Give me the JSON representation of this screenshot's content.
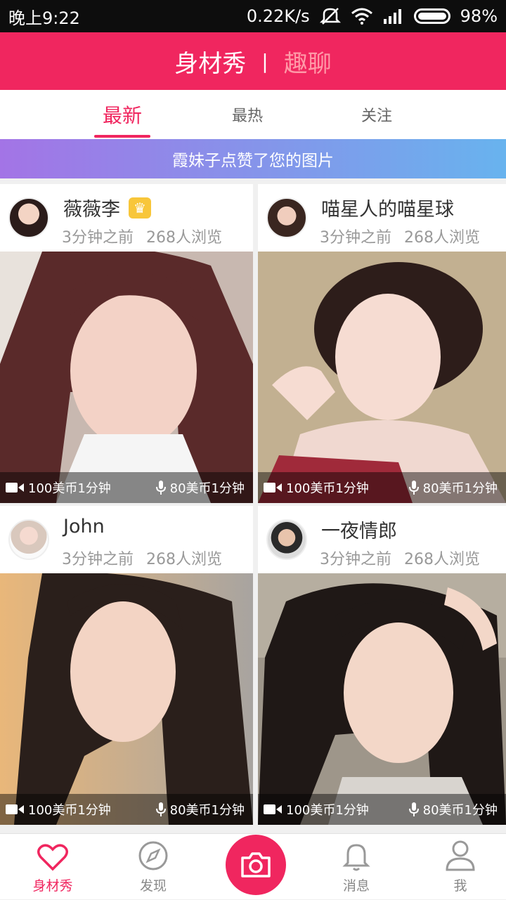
{
  "status": {
    "time": "晚上9:22",
    "speed": "0.22K/s",
    "battery": "98%"
  },
  "topbar": {
    "active": "身材秀",
    "separator": "|",
    "inactive": "趣聊"
  },
  "tabs": [
    {
      "label": "最新"
    },
    {
      "label": "最热"
    },
    {
      "label": "关注"
    }
  ],
  "notice": "霞妹子点赞了您的图片",
  "cards": [
    {
      "name": "薇薇李",
      "time": "3分钟之前",
      "views": "268人浏览",
      "video_price": "100美币1分钟",
      "voice_price": "80美币1分钟",
      "badge_icon": "crown-icon"
    },
    {
      "name": "喵星人的喵星球",
      "time": "3分钟之前",
      "views": "268人浏览",
      "video_price": "100美币1分钟",
      "voice_price": "80美币1分钟"
    },
    {
      "name": "John",
      "time": "3分钟之前",
      "views": "268人浏览",
      "video_price": "100美币1分钟",
      "voice_price": "80美币1分钟"
    },
    {
      "name": "一夜情郎",
      "time": "3分钟之前",
      "views": "268人浏览",
      "video_price": "100美币1分钟",
      "voice_price": "80美币1分钟"
    }
  ],
  "nav": [
    {
      "label": "身材秀",
      "icon": "heart-icon"
    },
    {
      "label": "发现",
      "icon": "compass-icon"
    },
    {
      "label": "",
      "icon": "camera-icon"
    },
    {
      "label": "消息",
      "icon": "bell-icon"
    },
    {
      "label": "我",
      "icon": "user-icon"
    }
  ],
  "colors": {
    "brand": "#f0265f",
    "notice_start": "#a374e6",
    "notice_end": "#68b3ee"
  }
}
